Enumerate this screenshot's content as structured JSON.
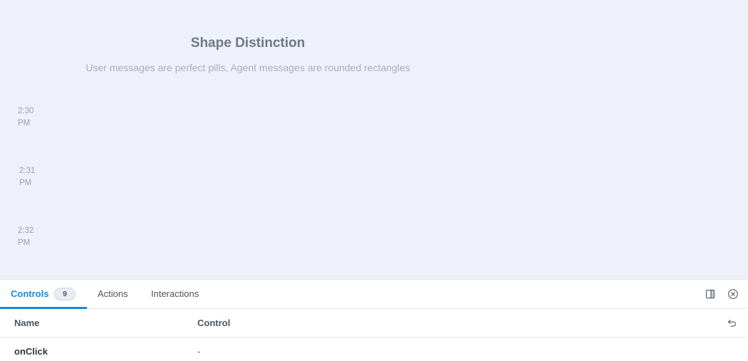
{
  "preview": {
    "title": "Shape Distinction",
    "subtitle": "User messages are perfect pills, Agent messages are rounded rectangles",
    "timestamps": [
      {
        "time": "2:30",
        "period": "PM"
      },
      {
        "time": "2:31",
        "period": "PM"
      },
      {
        "time": "2:32",
        "period": "PM"
      }
    ]
  },
  "panel": {
    "tabs": [
      {
        "label": "Controls",
        "badge": "9"
      },
      {
        "label": "Actions"
      },
      {
        "label": "Interactions"
      }
    ],
    "columns": {
      "name": "Name",
      "control": "Control"
    },
    "rows": [
      {
        "name": "onClick",
        "value": "-"
      }
    ]
  },
  "colors": {
    "accent": "#1a8ad6",
    "preview_background": "#eef1f9"
  },
  "icons": [
    "panel-layout-icon",
    "close-circle-icon",
    "reset-undo-icon"
  ]
}
